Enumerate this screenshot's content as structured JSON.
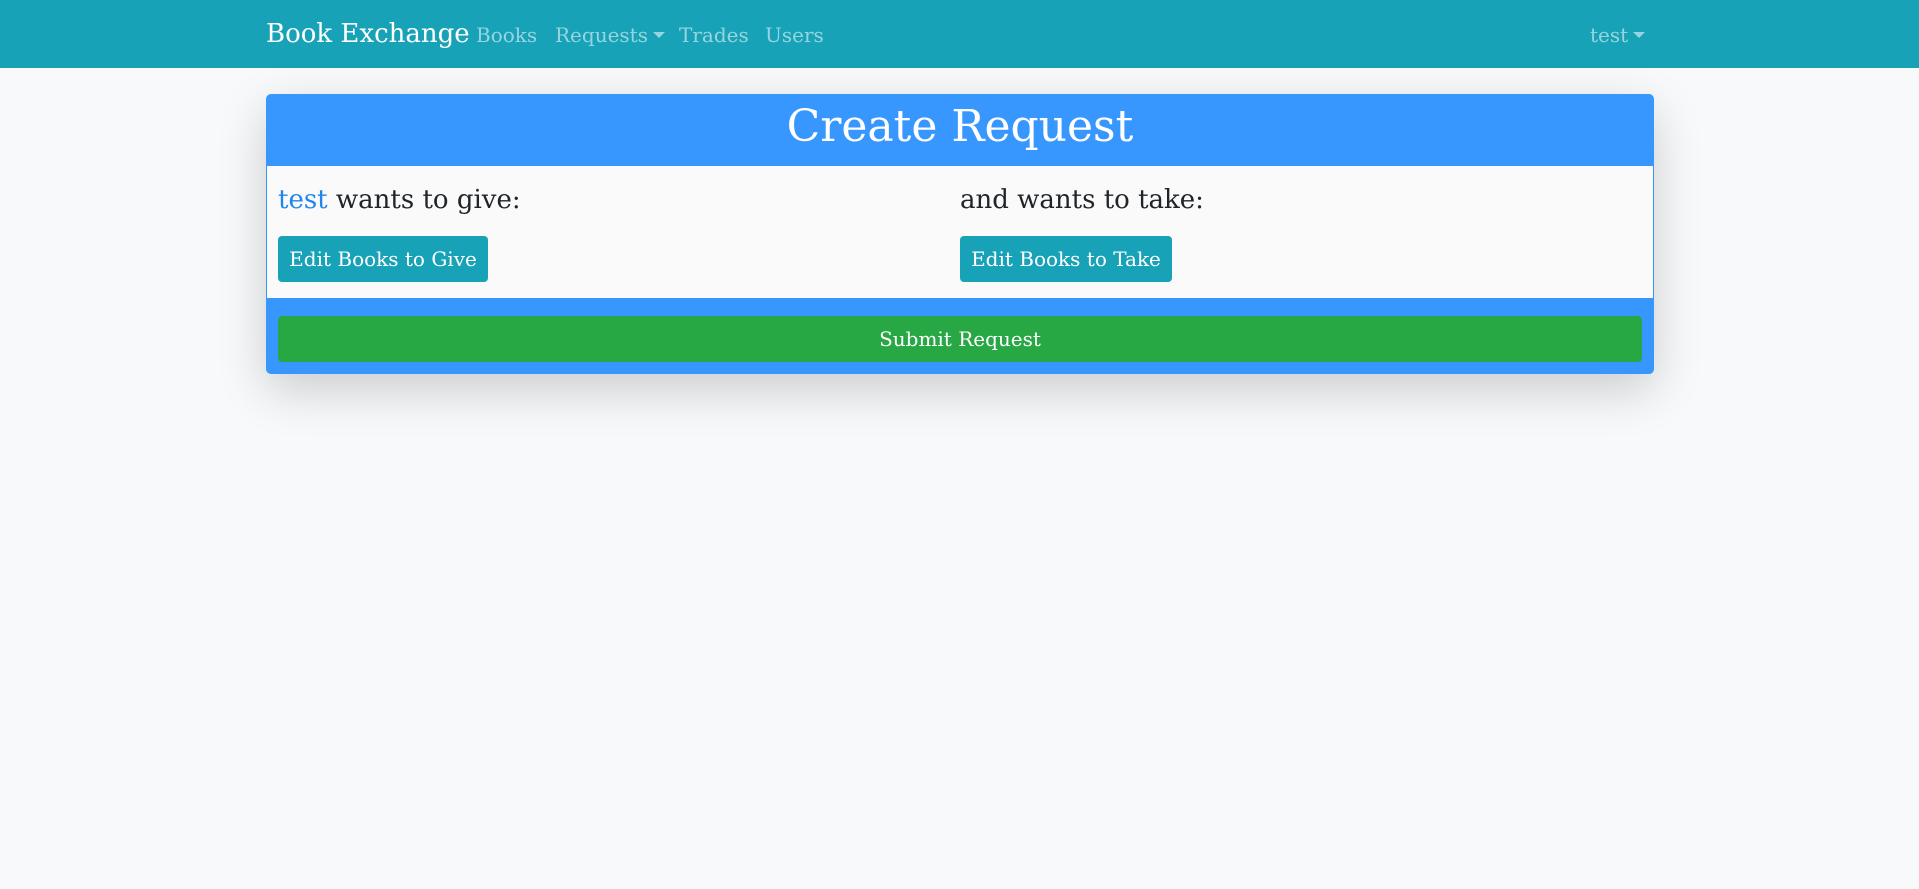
{
  "navbar": {
    "brand": "Book Exchange",
    "links": [
      {
        "label": "Books"
      },
      {
        "label": "Requests"
      },
      {
        "label": "Trades"
      },
      {
        "label": "Users"
      }
    ],
    "user_menu": "test"
  },
  "card": {
    "title": "Create Request",
    "give": {
      "username": "test",
      "heading": "wants to give:",
      "button": "Edit Books to Give"
    },
    "take": {
      "heading": "and wants to take:",
      "button": "Edit Books to Take"
    },
    "submit": "Submit Request"
  },
  "colors": {
    "navbar": "#17a2b8",
    "card_header": "#3797ff",
    "info_button": "#17a2b8",
    "submit_button": "#28a745",
    "user_link": "#1e86ec"
  }
}
